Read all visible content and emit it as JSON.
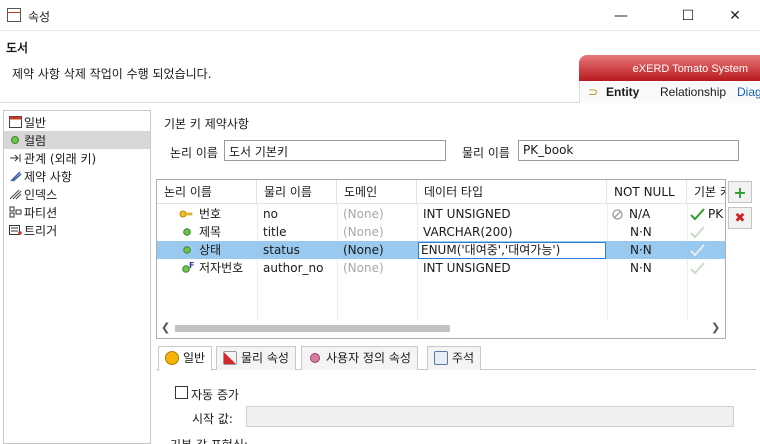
{
  "window": {
    "title": "속성",
    "minimize": "—",
    "maximize": "☐",
    "close": "✕"
  },
  "header": {
    "title": "도서",
    "message": "제약 사항 삭제 작업이 수행 되었습니다.",
    "logo_text": "eXERD Tomato System",
    "logo_tabs": [
      "Entity",
      "Relationship",
      "Diag"
    ]
  },
  "nav": {
    "items": [
      {
        "label": "일반",
        "icon": "general-icon",
        "selected": false
      },
      {
        "label": "컬럼",
        "icon": "column-icon",
        "selected": true
      },
      {
        "label": "관계 (외래 키)",
        "icon": "relation-icon",
        "selected": false
      },
      {
        "label": "제약 사항",
        "icon": "constraint-icon",
        "selected": false
      },
      {
        "label": "인덱스",
        "icon": "index-icon",
        "selected": false
      },
      {
        "label": "파티션",
        "icon": "partition-icon",
        "selected": false
      },
      {
        "label": "트리거",
        "icon": "trigger-icon",
        "selected": false
      }
    ]
  },
  "pk_group": {
    "title": "기본 키 제약사항",
    "logical_label": "논리 이름",
    "logical_value": "도서 기본키",
    "physical_label": "물리 이름",
    "physical_value": "PK_book"
  },
  "table": {
    "headers": [
      "논리 이름",
      "물리 이름",
      "도메인",
      "데이터 타입",
      "NOT NULL",
      "기본 키"
    ],
    "rows": [
      {
        "icon": "key-icon",
        "logical": "번호",
        "physical": "no",
        "domain": "(None)",
        "type": "INT UNSIGNED",
        "notnull": "N/A",
        "notnull_icon": "disabled-icon",
        "pk": "PK",
        "pk_icon": "check-green-icon",
        "selected": false
      },
      {
        "icon": "dot-icon",
        "logical": "제목",
        "physical": "title",
        "domain": "(None)",
        "type": "VARCHAR(200)",
        "notnull": "N·N",
        "notnull_icon": "",
        "pk": "",
        "pk_icon": "check-light-icon",
        "selected": false
      },
      {
        "icon": "dot-icon",
        "logical": "상태",
        "physical": "status",
        "domain": "(None)",
        "type": "ENUM('대여중','대여가능')",
        "notnull": "N·N",
        "notnull_icon": "",
        "pk": "",
        "pk_icon": "check-light-icon",
        "selected": true
      },
      {
        "icon": "fk-icon",
        "logical": "저자번호",
        "physical": "author_no",
        "domain": "(None)",
        "type": "INT UNSIGNED",
        "notnull": "N·N",
        "notnull_icon": "",
        "pk": "",
        "pk_icon": "check-light-icon",
        "selected": false
      }
    ]
  },
  "side_buttons": {
    "add": "+",
    "remove": "✖"
  },
  "bottom_tabs": [
    {
      "label": "일반",
      "icon": "general-tab-icon",
      "active": true
    },
    {
      "label": "물리 속성",
      "icon": "physical-tab-icon",
      "active": false
    },
    {
      "label": "사용자 정의 속성",
      "icon": "custom-tab-icon",
      "active": false
    },
    {
      "label": "주석",
      "icon": "comment-tab-icon",
      "active": false
    }
  ],
  "general": {
    "auto_increment_label": "자동 증가",
    "auto_increment_checked": false,
    "start_label": "시작 값:",
    "start_value": "",
    "default_label": "기본 값 표현식:"
  },
  "colors": {
    "selection": "#99c9ef",
    "brand_red": "#b8191e",
    "nav_selected": "#d7d7d7"
  }
}
